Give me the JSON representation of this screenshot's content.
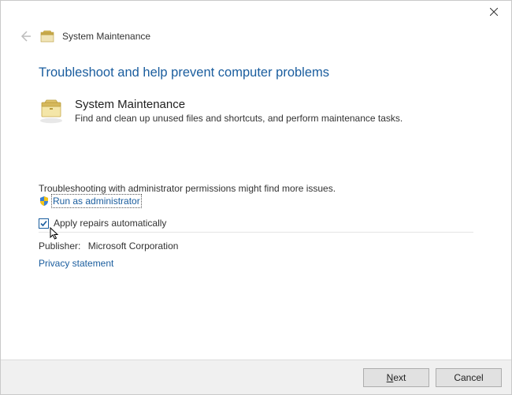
{
  "window": {
    "header_title": "System Maintenance"
  },
  "main": {
    "heading": "Troubleshoot and help prevent computer problems",
    "section_title": "System Maintenance",
    "section_desc": "Find and clean up unused files and shortcuts, and perform maintenance tasks."
  },
  "admin": {
    "hint": "Troubleshooting with administrator permissions might find more issues.",
    "link": "Run as administrator"
  },
  "checkbox": {
    "label": "Apply repairs automatically",
    "checked": true
  },
  "publisher": {
    "label": "Publisher:",
    "value": "Microsoft Corporation"
  },
  "privacy_link": "Privacy statement",
  "buttons": {
    "next_pre": "N",
    "next_rest": "ext",
    "cancel": "Cancel"
  }
}
